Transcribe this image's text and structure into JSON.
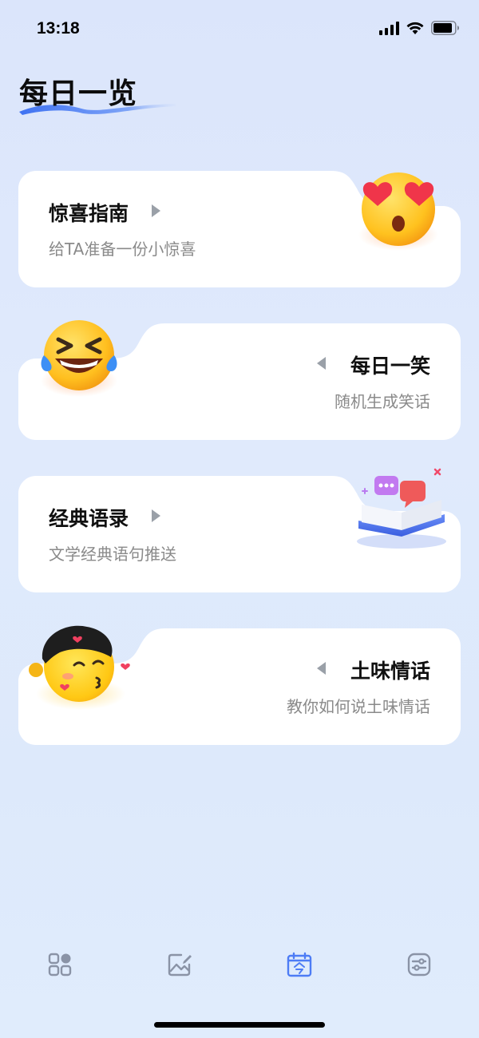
{
  "status_bar": {
    "time": "13:18"
  },
  "page": {
    "title": "每日一览"
  },
  "cards": [
    {
      "title": "惊喜指南",
      "subtitle": "给TA准备一份小惊喜",
      "icon": "heart-eyes-emoji-icon"
    },
    {
      "title": "每日一笑",
      "subtitle": "随机生成笑话",
      "icon": "laughing-emoji-icon"
    },
    {
      "title": "经典语录",
      "subtitle": "文学经典语句推送",
      "icon": "book-chat-bubbles-icon"
    },
    {
      "title": "土味情话",
      "subtitle": "教你如何说土味情话",
      "icon": "kissing-boy-emoji-icon"
    }
  ],
  "tabs": [
    {
      "icon": "grid-apps-icon",
      "active": false
    },
    {
      "icon": "image-edit-icon",
      "active": false
    },
    {
      "icon": "calendar-today-icon",
      "active": true
    },
    {
      "icon": "settings-sliders-icon",
      "active": false
    }
  ],
  "colors": {
    "accent": "#4d7cf5",
    "inactive_tab": "#8a93a6",
    "subtitle": "#8a8a8a",
    "card_bg": "#ffffff"
  }
}
